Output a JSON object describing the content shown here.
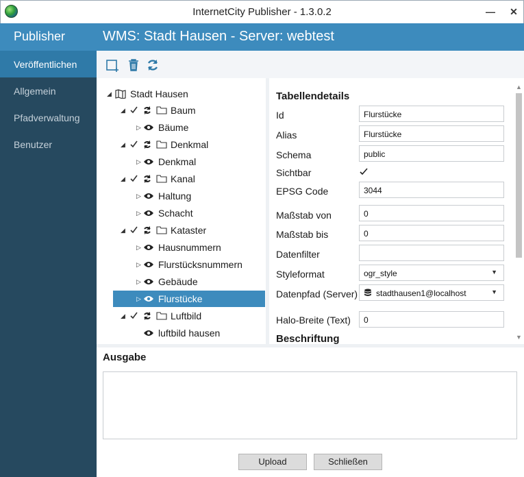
{
  "window": {
    "title": "InternetCity Publisher - 1.3.0.2",
    "minimize": "—",
    "close": "✕"
  },
  "sidebar": {
    "brand": "Publisher",
    "items": [
      {
        "label": "Veröffentlichen"
      },
      {
        "label": "Allgemein"
      },
      {
        "label": "Pfadverwaltung"
      },
      {
        "label": "Benutzer"
      }
    ]
  },
  "header": {
    "title": "WMS: Stadt Hausen - Server: webtest"
  },
  "toolbar": {
    "icons": [
      "add-layer-icon",
      "trash-icon",
      "refresh-icon"
    ]
  },
  "tree": {
    "root": "Stadt Hausen",
    "nodes": [
      {
        "label": "Baum"
      },
      {
        "label": "Bäume"
      },
      {
        "label": "Denkmal"
      },
      {
        "label": "Denkmal"
      },
      {
        "label": "Kanal"
      },
      {
        "label": "Haltung"
      },
      {
        "label": "Schacht"
      },
      {
        "label": "Kataster"
      },
      {
        "label": "Hausnummern"
      },
      {
        "label": "Flurstücksnummern"
      },
      {
        "label": "Gebäude"
      },
      {
        "label": "Flurstücke"
      },
      {
        "label": "Luftbild"
      },
      {
        "label": "luftbild hausen"
      }
    ]
  },
  "details": {
    "title": "Tabellendetails",
    "fields": {
      "id": {
        "label": "Id",
        "value": "Flurstücke"
      },
      "alias": {
        "label": "Alias",
        "value": "Flurstücke"
      },
      "schema": {
        "label": "Schema",
        "value": "public"
      },
      "visible": {
        "label": "Sichtbar",
        "checked": true
      },
      "epsg": {
        "label": "EPSG Code",
        "value": "3044"
      },
      "scale_from": {
        "label": "Maßstab von",
        "value": "0"
      },
      "scale_to": {
        "label": "Maßstab bis",
        "value": "0"
      },
      "filter": {
        "label": "Datenfilter",
        "value": ""
      },
      "style": {
        "label": "Styleformat",
        "value": "ogr_style"
      },
      "datapath": {
        "label": "Datenpfad (Server)",
        "value": "stadthausen1@localhost"
      },
      "halo": {
        "label": "Halo-Breite (Text)",
        "value": "0"
      }
    },
    "section2": "Beschriftung"
  },
  "output": {
    "title": "Ausgabe",
    "value": ""
  },
  "buttons": {
    "upload": "Upload",
    "close": "Schließen"
  },
  "colors": {
    "accent": "#3d8bbd",
    "sidebar": "#26495f",
    "selected": "#2f7aa8"
  }
}
